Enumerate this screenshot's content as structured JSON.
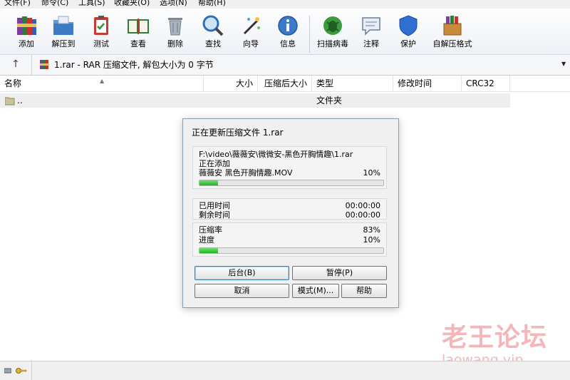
{
  "menu": [
    {
      "label": "文件(F)"
    },
    {
      "label": "命令(C)"
    },
    {
      "label": "工具(S)"
    },
    {
      "label": "收藏夹(O)"
    },
    {
      "label": "选项(N)"
    },
    {
      "label": "帮助(H)"
    }
  ],
  "toolbar": {
    "buttons": [
      {
        "label": "添加",
        "icon": "books-icon"
      },
      {
        "label": "解压到",
        "icon": "folder-extract-icon"
      },
      {
        "label": "测试",
        "icon": "clipboard-check-icon"
      },
      {
        "label": "查看",
        "icon": "open-book-icon"
      },
      {
        "label": "删除",
        "icon": "trash-icon"
      },
      {
        "label": "查找",
        "icon": "magnifier-icon"
      },
      {
        "label": "向导",
        "icon": "magic-wand-icon"
      },
      {
        "label": "信息",
        "icon": "info-icon"
      },
      {
        "label": "扫描病毒",
        "icon": "bug-icon"
      },
      {
        "label": "注释",
        "icon": "comment-icon"
      },
      {
        "label": "保护",
        "icon": "shield-icon"
      },
      {
        "label": "自解压格式",
        "icon": "sfx-box-icon"
      }
    ]
  },
  "address": {
    "up_label": "↑",
    "path": "1.rar - RAR 压缩文件, 解包大小为 0 字节",
    "dropdown": "▼"
  },
  "columns": [
    {
      "label": "名称"
    },
    {
      "label": "大小"
    },
    {
      "label": "压缩后大小"
    },
    {
      "label": "类型"
    },
    {
      "label": "修改时间"
    },
    {
      "label": "CRC32"
    }
  ],
  "files": [
    {
      "name": "..",
      "type": "文件夹"
    }
  ],
  "dialog": {
    "title": "正在更新压缩文件 1.rar",
    "archive_path": "F:\\video\\薇薇安\\微微安-黑色开胸情趣\\1.rar",
    "action": "正在添加",
    "current_file": "薇薇安 黑色开胸情趣.MOV",
    "file_percent": "10%",
    "file_progress": 0.1,
    "elapsed_label": "已用时间",
    "elapsed_value": "00:00:00",
    "remaining_label": "剩余时间",
    "remaining_value": "00:00:00",
    "ratio_label": "压缩率",
    "ratio_value": "83%",
    "progress_label": "进度",
    "progress_value": "10%",
    "total_progress": 0.1,
    "buttons": {
      "background": "后台(B)",
      "pause": "暂停(P)",
      "cancel": "取消",
      "mode": "模式(M)...",
      "help": "帮助"
    }
  },
  "watermark": {
    "main": "老王论坛",
    "sub": "laowang.vip"
  },
  "colors": {
    "progress": "#22b522",
    "watermark": "#e46066"
  }
}
